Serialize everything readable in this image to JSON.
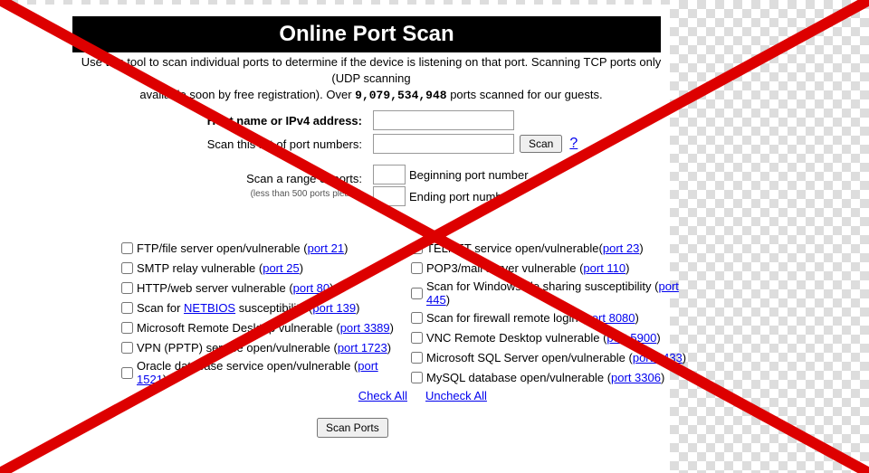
{
  "header": {
    "title": "Online Port Scan"
  },
  "intro": {
    "line1a": "Use this tool to scan individual ports to determine if the device is listening on that port.",
    "line1b": "Scanning TCP ports only (UDP scanning",
    "line2a": "available soon by free registration).  Over",
    "count": "9,079,534,948",
    "line2b": "ports scanned for our guests."
  },
  "form": {
    "host_label": "Host name or IPv4 address:",
    "portlist_label": "Scan this list of port numbers:",
    "scan_btn": "Scan",
    "help": "?",
    "range_label": "Scan a range of ports:",
    "range_hint": "(less than 500 ports please)",
    "begin_label": "Beginning port number",
    "end_label": "Ending port number"
  },
  "checks_left": [
    {
      "pre": "FTP/file server open/vulnerable (",
      "link": "port 21",
      "post": ")"
    },
    {
      "pre": "SMTP relay vulnerable (",
      "link": "port 25",
      "post": ")"
    },
    {
      "pre": "HTTP/web server vulnerable (",
      "link": "port 80",
      "post": ")"
    },
    {
      "pre": "Scan for ",
      "link": "NETBIOS",
      "post": " susceptibility (",
      "link2": "port 139",
      "post2": ")"
    },
    {
      "pre": "Microsoft Remote Desktop vulnerable (",
      "link": "port 3389",
      "post": ")"
    },
    {
      "pre": "VPN (PPTP) service open/vulnerable (",
      "link": "port 1723",
      "post": ")"
    },
    {
      "pre": "Oracle database service open/vulnerable (",
      "link": "port 1521",
      "post": ")"
    }
  ],
  "checks_right": [
    {
      "pre": "TELNET service open/vulnerable(",
      "link": "port 23",
      "post": ")"
    },
    {
      "pre": "POP3/mail server vulnerable (",
      "link": "port 110",
      "post": ")"
    },
    {
      "pre": "Scan for Windows file sharing susceptibility (",
      "link": "port 445",
      "post": ")"
    },
    {
      "pre": "Scan for firewall remote login (",
      "link": "port 8080",
      "post": ")"
    },
    {
      "pre": "VNC Remote Desktop vulnerable (",
      "link": "port 5900",
      "post": ")"
    },
    {
      "pre": "Microsoft SQL Server open/vulnerable (",
      "link": "port 1433",
      "post": ")"
    },
    {
      "pre": "MySQL database open/vulnerable (",
      "link": "port 3306",
      "post": ")"
    }
  ],
  "links": {
    "check_all": "Check All",
    "uncheck_all": "Uncheck All"
  },
  "buttons": {
    "scan_ports": "Scan Ports"
  }
}
